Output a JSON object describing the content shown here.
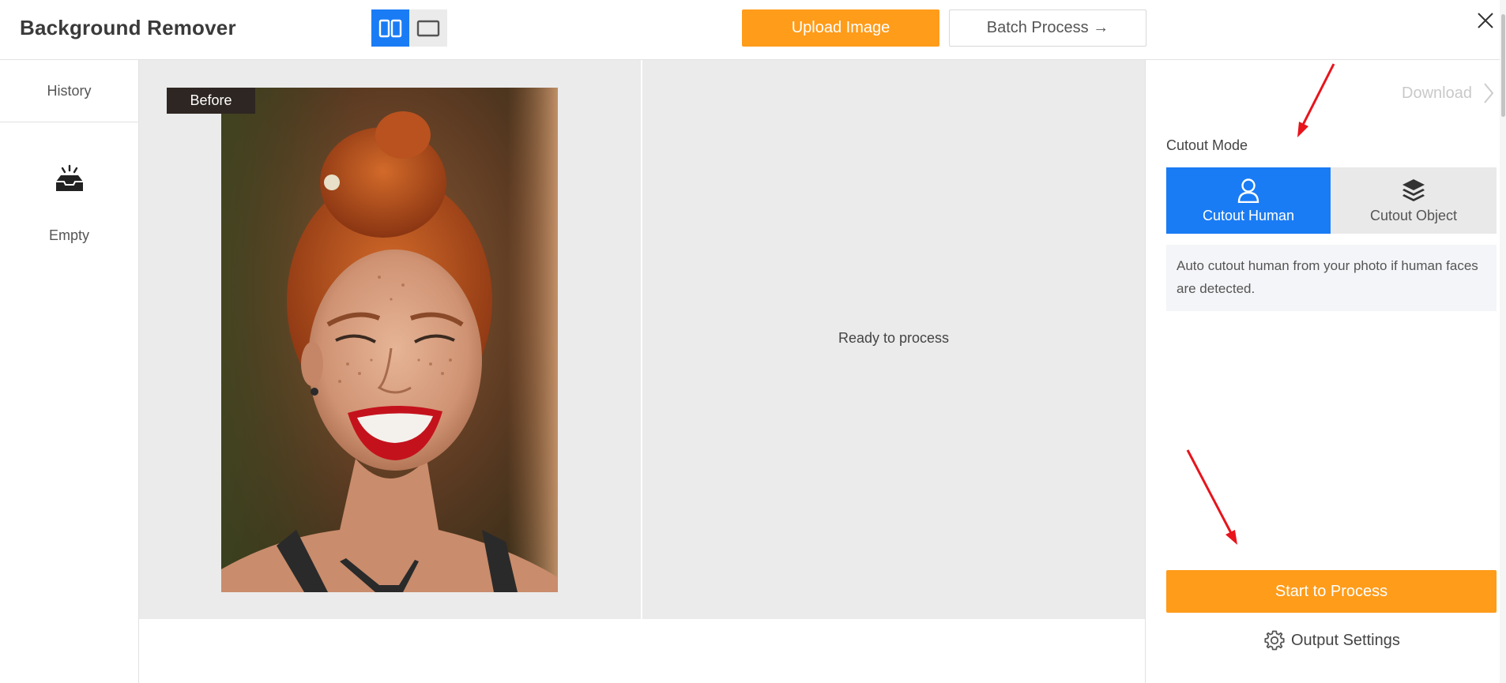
{
  "header": {
    "title": "Background Remover",
    "upload_label": "Upload Image",
    "batch_label": "Batch Process →",
    "view_modes": [
      "split-view-icon",
      "single-view-icon"
    ],
    "active_view": "split-view-icon"
  },
  "sidebar": {
    "history_label": "History",
    "empty_label": "Empty",
    "empty_icon": "inbox-tray-icon"
  },
  "preview": {
    "before_label": "Before",
    "ready_label": "Ready to process"
  },
  "right_panel": {
    "download_label": "Download",
    "cutout_mode_label": "Cutout Mode",
    "modes": [
      {
        "label": "Cutout Human",
        "icon": "person-icon",
        "selected": true
      },
      {
        "label": "Cutout Object",
        "icon": "layers-icon",
        "selected": false
      }
    ],
    "mode_description": "Auto cutout human from your photo if human faces are detected.",
    "start_label": "Start to Process",
    "output_settings_label": "Output Settings"
  },
  "colors": {
    "accent_orange": "#ff9c1a",
    "accent_blue": "#1a7cf5",
    "annotation_red": "#e8141c"
  }
}
